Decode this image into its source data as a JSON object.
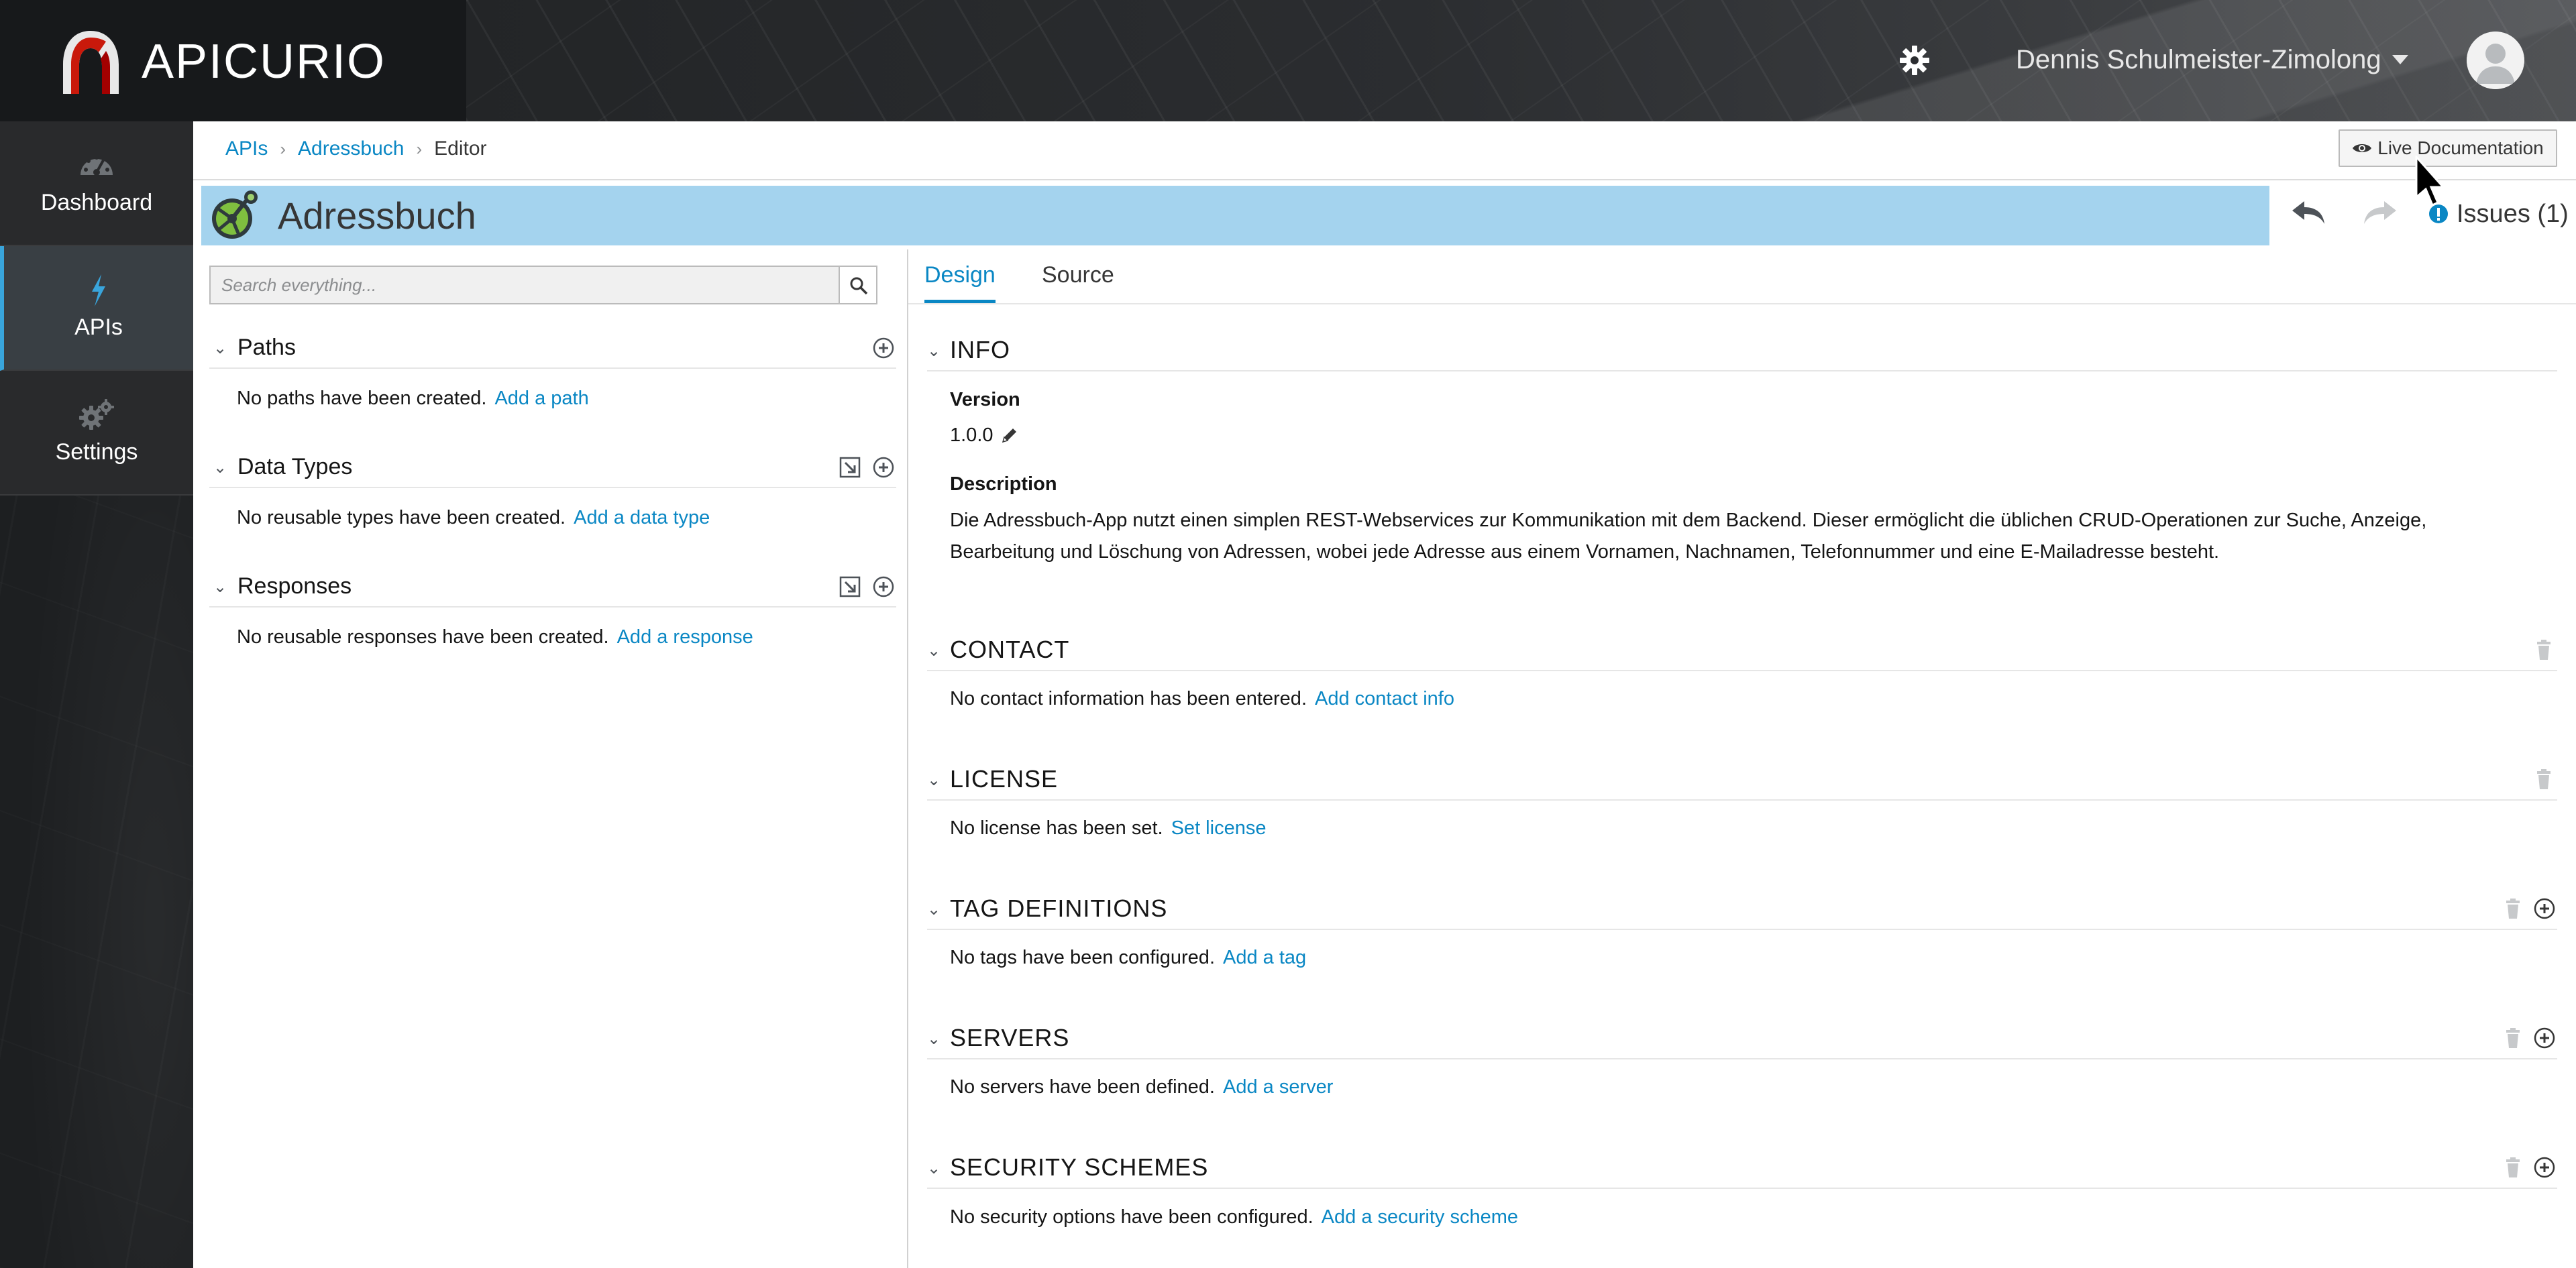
{
  "app": {
    "brand": "APICURIO",
    "user_name": "Dennis Schulmeister-Zimolong"
  },
  "colors": {
    "accent": "#0a87c4",
    "title_bar": "#a4d3ee",
    "nav_active_border": "#39a5dc",
    "topbar": "#202224",
    "sidenav": "#292a2c"
  },
  "icons": {
    "brand_logo": "apicurio-logo",
    "settings": "gear-icon",
    "user_menu": "caret-down-icon",
    "avatar": "user-avatar-icon",
    "dashboard": "tachometer-icon",
    "apis": "bolt-icon",
    "nav_settings": "cogs-icon",
    "live_doc": "eye-icon",
    "undo": "undo-icon",
    "redo": "redo-icon",
    "issues": "issues-icon",
    "search": "search-icon",
    "add": "plus-circle-icon",
    "import": "import-icon",
    "edit": "pencil-icon",
    "delete": "trash-icon",
    "collapse": "chevron-down-icon"
  },
  "sidenav": {
    "items": [
      {
        "label": "Dashboard",
        "active": false
      },
      {
        "label": "APIs",
        "active": true
      },
      {
        "label": "Settings",
        "active": false
      }
    ]
  },
  "breadcrumb": {
    "items": [
      "APIs",
      "Adressbuch"
    ],
    "current": "Editor"
  },
  "toolbar": {
    "live_doc_label": "Live Documentation",
    "issues_label": "Issues (1)"
  },
  "api": {
    "title": "Adressbuch"
  },
  "left_panel": {
    "search_placeholder": "Search everything...",
    "sections": [
      {
        "title": "Paths",
        "empty_text": "No paths have been created.",
        "action": "Add a path"
      },
      {
        "title": "Data Types",
        "empty_text": "No reusable types have been created.",
        "action": "Add a data type"
      },
      {
        "title": "Responses",
        "empty_text": "No reusable responses have been created.",
        "action": "Add a response"
      }
    ]
  },
  "tabs": [
    {
      "label": "Design",
      "active": true
    },
    {
      "label": "Source",
      "active": false
    }
  ],
  "info": {
    "title": "INFO",
    "version_label": "Version",
    "version": "1.0.0",
    "description_label": "Description",
    "description": "Die Adressbuch-App nutzt einen simplen REST-Webservices zur Kommunikation mit dem Backend. Dieser ermöglicht die üblichen CRUD-Operationen zur Suche, Anzeige, Bearbeitung und Löschung von Adressen, wobei jede Adresse aus einem Vornamen, Nachnamen, Telefonnummer und eine E-Mailadresse besteht."
  },
  "sections": [
    {
      "title": "CONTACT",
      "empty_text": "No contact information has been entered.",
      "action": "Add contact info"
    },
    {
      "title": "LICENSE",
      "empty_text": "No license has been set.",
      "action": "Set license"
    },
    {
      "title": "TAG DEFINITIONS",
      "empty_text": "No tags have been configured.",
      "action": "Add a tag"
    },
    {
      "title": "SERVERS",
      "empty_text": "No servers have been defined.",
      "action": "Add a server"
    },
    {
      "title": "SECURITY SCHEMES",
      "empty_text": "No security options have been configured.",
      "action": "Add a security scheme"
    }
  ]
}
